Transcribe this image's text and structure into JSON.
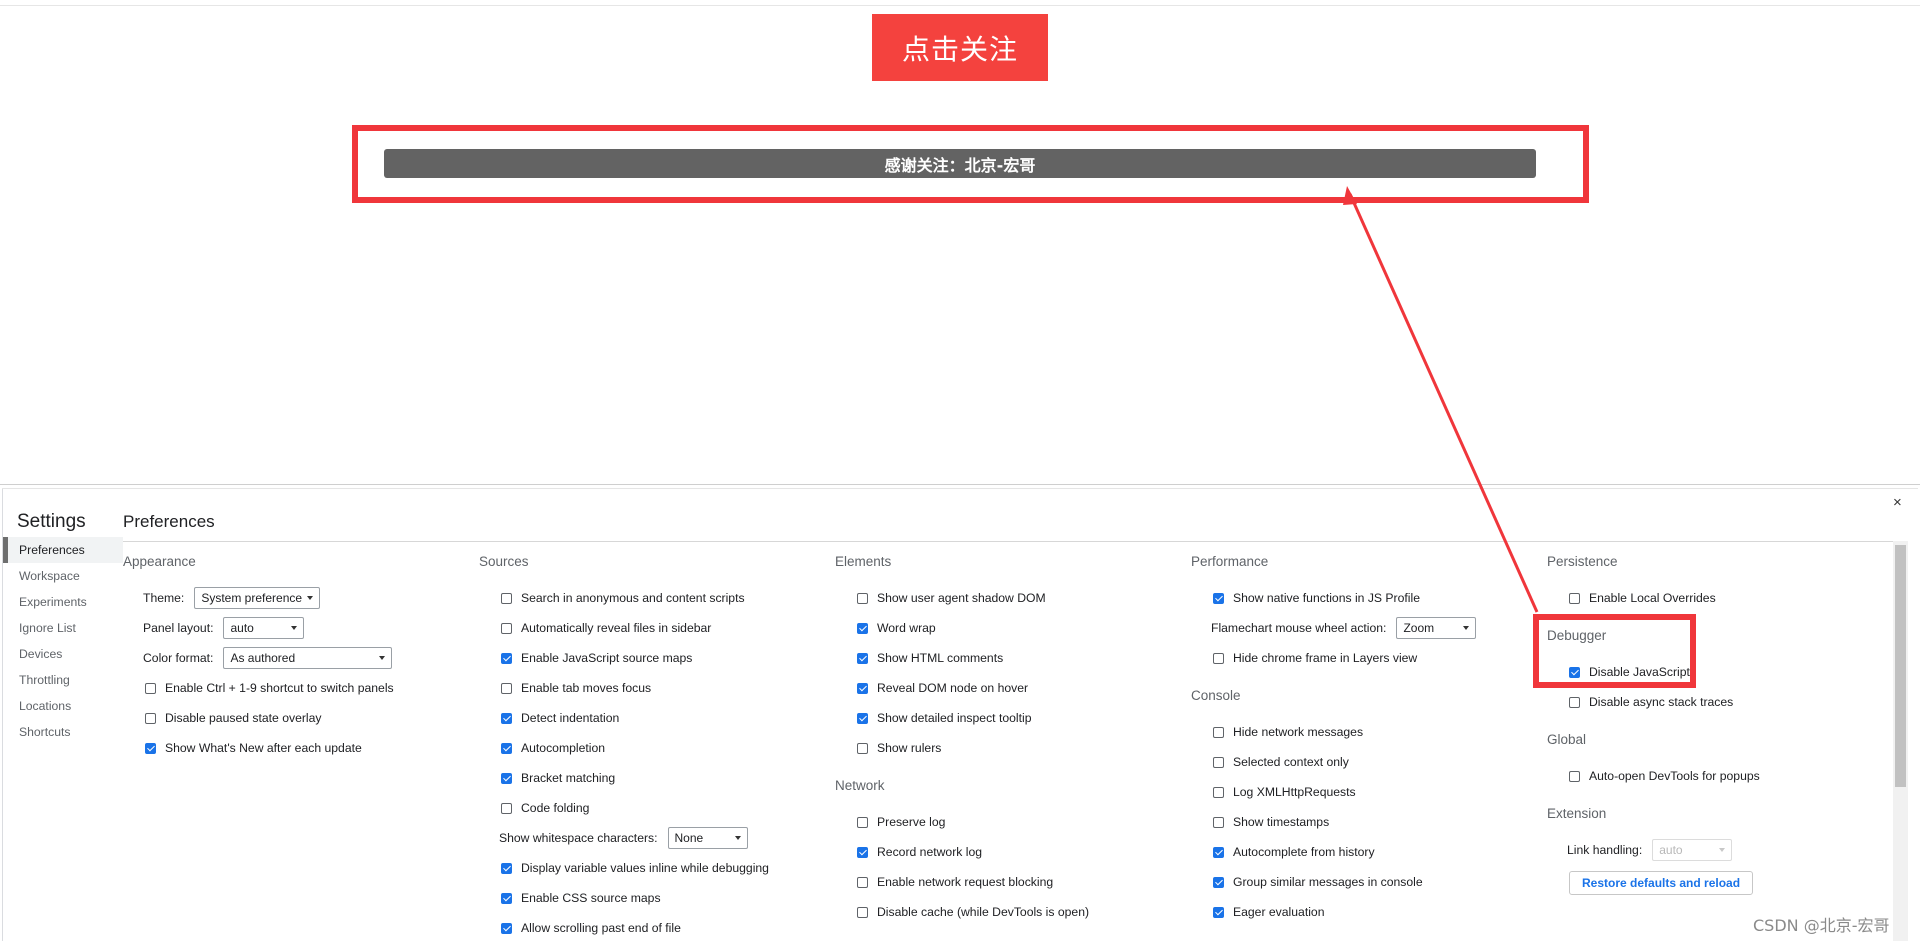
{
  "page": {
    "follow_button": "点击关注",
    "thanks_text": "感谢关注：北京-宏哥",
    "watermark": "CSDN @北京-宏哥"
  },
  "colors": {
    "follow_button_bg": "#f4423e",
    "annotation_red": "#f0363b",
    "checkbox_blue": "#1a73e8",
    "thanks_bar_bg": "#636363"
  },
  "devtools": {
    "close_icon": "×",
    "settings_title": "Settings",
    "nav": [
      "Preferences",
      "Workspace",
      "Experiments",
      "Ignore List",
      "Devices",
      "Throttling",
      "Locations",
      "Shortcuts"
    ],
    "active_nav": "Preferences",
    "panel_title": "Preferences",
    "appearance": {
      "heading": "Appearance",
      "theme_label": "Theme:",
      "theme_value": "System preference",
      "panel_layout_label": "Panel layout:",
      "panel_layout_value": "auto",
      "color_format_label": "Color format:",
      "color_format_value": "As authored",
      "checks": [
        {
          "label": "Enable Ctrl + 1-9 shortcut to switch panels",
          "checked": false
        },
        {
          "label": "Disable paused state overlay",
          "checked": false
        },
        {
          "label": "Show What's New after each update",
          "checked": true
        }
      ]
    },
    "sources": {
      "heading": "Sources",
      "checks_a": [
        {
          "label": "Search in anonymous and content scripts",
          "checked": false
        },
        {
          "label": "Automatically reveal files in sidebar",
          "checked": false
        },
        {
          "label": "Enable JavaScript source maps",
          "checked": true
        },
        {
          "label": "Enable tab moves focus",
          "checked": false
        },
        {
          "label": "Detect indentation",
          "checked": true
        },
        {
          "label": "Autocompletion",
          "checked": true
        },
        {
          "label": "Bracket matching",
          "checked": true
        },
        {
          "label": "Code folding",
          "checked": false
        }
      ],
      "whitespace_label": "Show whitespace characters:",
      "whitespace_value": "None",
      "checks_b": [
        {
          "label": "Display variable values inline while debugging",
          "checked": true
        },
        {
          "label": "Enable CSS source maps",
          "checked": true
        },
        {
          "label": "Allow scrolling past end of file",
          "checked": true
        }
      ]
    },
    "elements": {
      "heading": "Elements",
      "checks": [
        {
          "label": "Show user agent shadow DOM",
          "checked": false
        },
        {
          "label": "Word wrap",
          "checked": true
        },
        {
          "label": "Show HTML comments",
          "checked": true
        },
        {
          "label": "Reveal DOM node on hover",
          "checked": true
        },
        {
          "label": "Show detailed inspect tooltip",
          "checked": true
        },
        {
          "label": "Show rulers",
          "checked": false
        }
      ]
    },
    "network": {
      "heading": "Network",
      "checks": [
        {
          "label": "Preserve log",
          "checked": false
        },
        {
          "label": "Record network log",
          "checked": true
        },
        {
          "label": "Enable network request blocking",
          "checked": false
        },
        {
          "label": "Disable cache (while DevTools is open)",
          "checked": false
        }
      ]
    },
    "performance": {
      "heading": "Performance",
      "checks_a": [
        {
          "label": "Show native functions in JS Profile",
          "checked": true
        }
      ],
      "wheel_label": "Flamechart mouse wheel action:",
      "wheel_value": "Zoom",
      "checks_b": [
        {
          "label": "Hide chrome frame in Layers view",
          "checked": false
        }
      ]
    },
    "console": {
      "heading": "Console",
      "checks": [
        {
          "label": "Hide network messages",
          "checked": false
        },
        {
          "label": "Selected context only",
          "checked": false
        },
        {
          "label": "Log XMLHttpRequests",
          "checked": false
        },
        {
          "label": "Show timestamps",
          "checked": false
        },
        {
          "label": "Autocomplete from history",
          "checked": true
        },
        {
          "label": "Group similar messages in console",
          "checked": true
        },
        {
          "label": "Eager evaluation",
          "checked": true
        }
      ]
    },
    "persistence": {
      "heading": "Persistence",
      "checks": [
        {
          "label": "Enable Local Overrides",
          "checked": false
        }
      ]
    },
    "debugger": {
      "heading": "Debugger",
      "checks": [
        {
          "label": "Disable JavaScript",
          "checked": true
        },
        {
          "label": "Disable async stack traces",
          "checked": false
        }
      ]
    },
    "global": {
      "heading": "Global",
      "checks": [
        {
          "label": "Auto-open DevTools for popups",
          "checked": false
        }
      ]
    },
    "extension": {
      "heading": "Extension",
      "link_label": "Link handling:",
      "link_value": "auto"
    },
    "restore_button": "Restore defaults and reload"
  }
}
